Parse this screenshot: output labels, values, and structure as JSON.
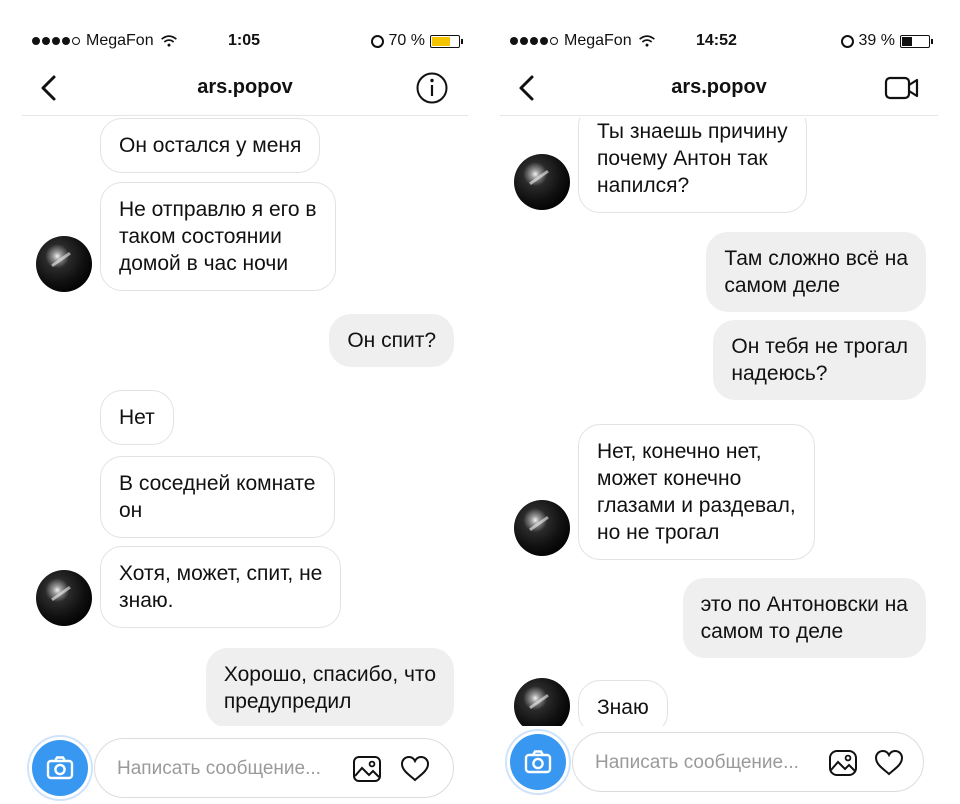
{
  "left": {
    "status": {
      "carrier": "MegaFon",
      "time": "1:05",
      "battery": "70 %",
      "battery_level": 0.7,
      "battery_color": "#f5c400"
    },
    "header": {
      "title": "ars.popov",
      "action_icon": "info-icon"
    },
    "messages": [
      {
        "side": "in",
        "text": "Он остался у меня"
      },
      {
        "side": "in",
        "text": "Не отправлю я его в\nтаком состоянии\nдомой в час ночи"
      },
      {
        "side": "out",
        "text": "Он спит?"
      },
      {
        "side": "in",
        "text": "Нет"
      },
      {
        "side": "in",
        "text": "В соседней комнате\nон"
      },
      {
        "side": "in",
        "text": "Хотя, может, спит, не\nзнаю."
      },
      {
        "side": "out",
        "text": "Хорошо, спасибо, что\nпредупредил"
      }
    ],
    "composer": {
      "placeholder": "Написать сообщение..."
    }
  },
  "right": {
    "status": {
      "carrier": "MegaFon",
      "time": "14:52",
      "battery": "39 %",
      "battery_level": 0.39,
      "battery_color": "#111111"
    },
    "header": {
      "title": "ars.popov",
      "action_icon": "video-call-icon"
    },
    "messages": [
      {
        "side": "in",
        "text": "Ты знаешь причину\nпочему Антон так\nнапился?"
      },
      {
        "side": "out",
        "text": "Там сложно всё на\nсамом деле"
      },
      {
        "side": "out",
        "text": "Он тебя не трогал\nнадеюсь?"
      },
      {
        "side": "in",
        "text": "Нет, конечно нет,\nможет конечно\nглазами и раздевал,\nно не трогал"
      },
      {
        "side": "out",
        "text": "это по Антоновски на\nсамом то деле"
      },
      {
        "side": "in",
        "text": "Знаю"
      }
    ],
    "composer": {
      "placeholder": "Написать сообщение..."
    }
  },
  "colors": {
    "accent": "#3897f0",
    "outgoing_bubble": "#efefef",
    "incoming_border": "#e2e2e2"
  }
}
